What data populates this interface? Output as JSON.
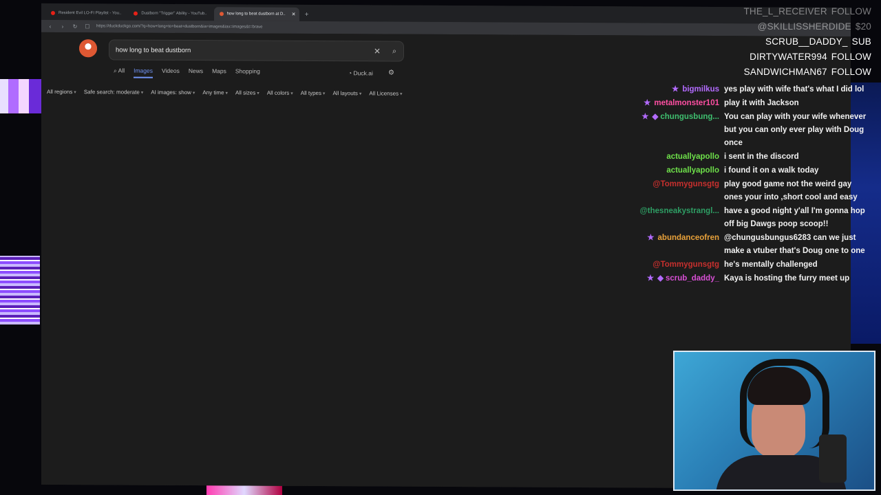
{
  "browser": {
    "tabs": [
      {
        "title": "Resident Evil LO-FI Playlist - You..",
        "active": false
      },
      {
        "title": "Dustborn \"Trigger\" Ability - YouTub..",
        "active": false
      },
      {
        "title": "how long to beat dustborn at D..",
        "active": true
      }
    ],
    "new_tab": "+",
    "url": "https://duckduckgo.com/?q=how+long+to+beat+dustborn&ia=images&iax=images&t=brave"
  },
  "search": {
    "query": "how long to beat dustborn",
    "tabs": [
      "All",
      "Images",
      "Videos",
      "News",
      "Maps",
      "Shopping"
    ],
    "active_tab": "Images",
    "duck_ai": "Duck.ai",
    "filters": [
      "All regions",
      "Safe search: moderate",
      "AI images: show",
      "Any time",
      "All sizes",
      "All colors",
      "All types",
      "All layouts",
      "All Licenses"
    ]
  },
  "alerts": [
    {
      "name": "THE_L_RECEIVER",
      "action": "FOLLOW"
    },
    {
      "name": "@SKILLISSHERDIDE",
      "action": "$20"
    },
    {
      "name": "SCRUB__DADDY_",
      "action": "SUB"
    },
    {
      "name": "DIRTYWATER994",
      "action": "FOLLOW"
    },
    {
      "name": "SANDWICHMAN67",
      "action": "FOLLOW"
    }
  ],
  "chat": [
    {
      "user": "bigmilkus",
      "color": "#b36bff",
      "badge": true,
      "text": "yes play with wife that's what I did lol"
    },
    {
      "user": "metalmonster101",
      "color": "#ff4fa3",
      "badge": true,
      "text": "play it with Jackson"
    },
    {
      "user": "chungusbung...",
      "color": "#3fbf6f",
      "badge": true,
      "badge2": true,
      "text": "You can play with your wife whenever but you can only ever play with Doug once"
    },
    {
      "user": "actuallyapollo",
      "color": "#6ee04a",
      "badge": false,
      "text": "i sent in the discord"
    },
    {
      "user": "actuallyapollo",
      "color": "#6ee04a",
      "badge": false,
      "text": "i found it on a walk today"
    },
    {
      "user": "@Tommygunsgtg",
      "color": "#c8302e",
      "badge": false,
      "text": "play good game not the weird gay ones your into ,short cool and easy"
    },
    {
      "user": "@thesneakystrangl...",
      "color": "#2e9e64",
      "badge": false,
      "text": "have a good night y'all I'm gonna hop off big Dawgs poop scoop!!"
    },
    {
      "user": "abundanceofren",
      "color": "#e8a13a",
      "badge": true,
      "text": "@chungusbungus6283 can we just make a vtuber that's Doug one to one"
    },
    {
      "user": "@Tommygunsgtg",
      "color": "#c8302e",
      "badge": false,
      "text": "he's mentally challenged"
    },
    {
      "user": "scrub_daddy_",
      "color": "#d94fd6",
      "badge": true,
      "badge2": true,
      "text": "Kaya is hosting the furry meet up"
    }
  ]
}
